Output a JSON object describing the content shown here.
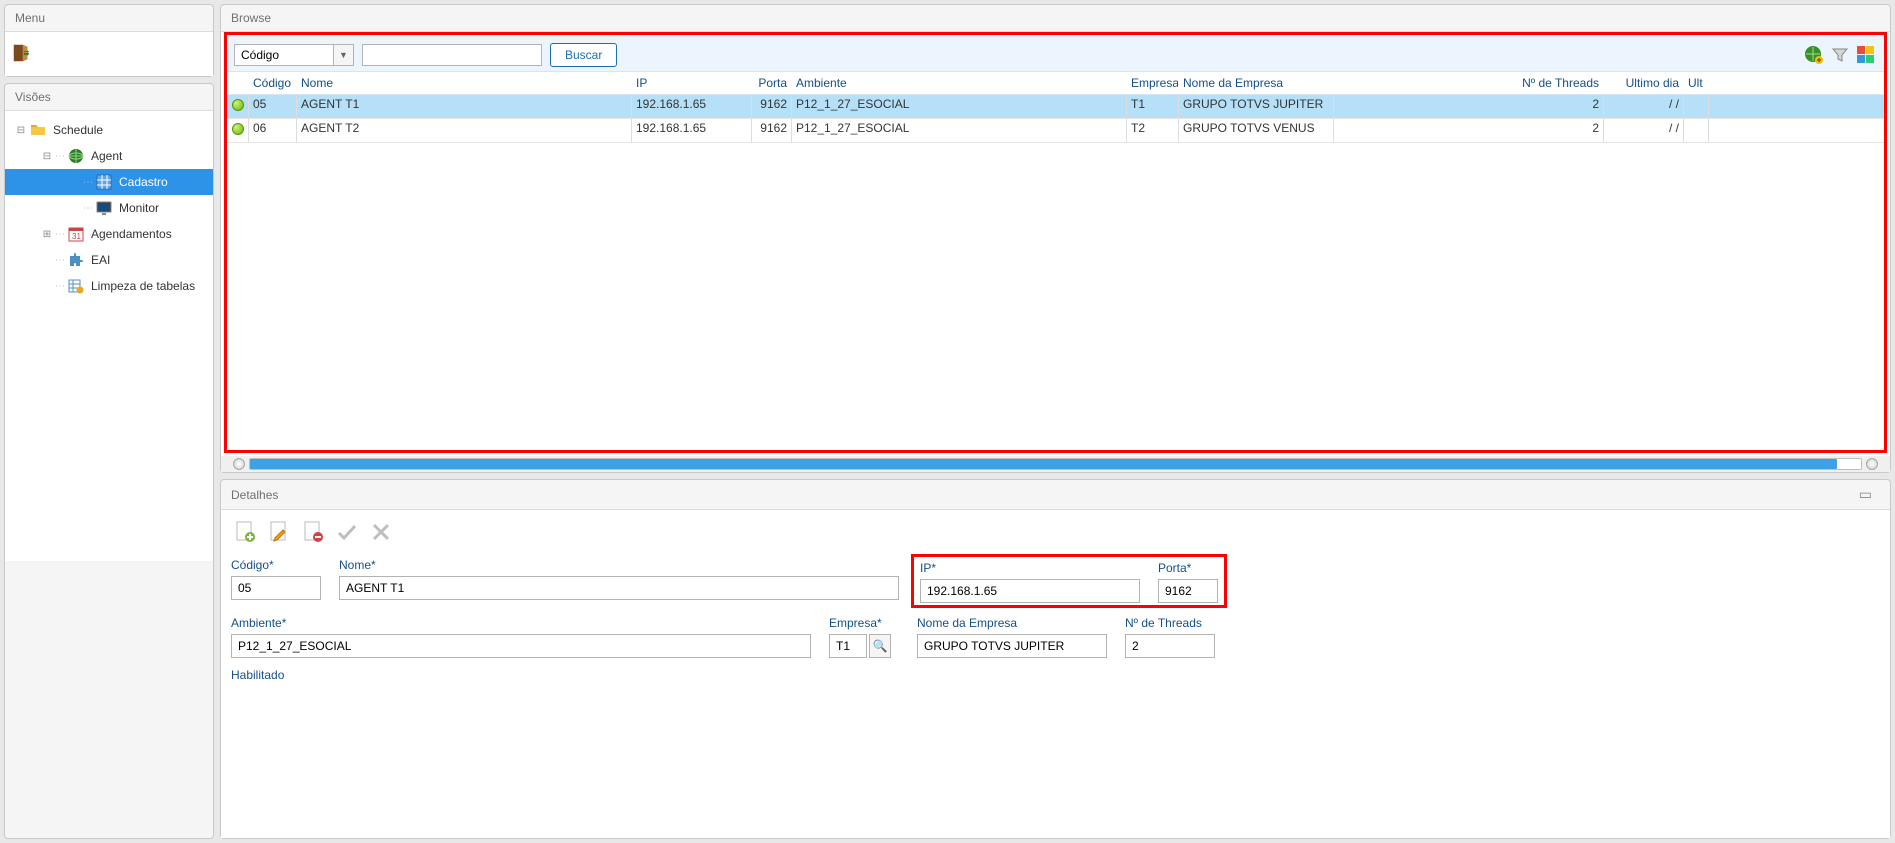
{
  "menu": {
    "title": "Menu"
  },
  "visions": {
    "title": "Visões",
    "items": [
      {
        "label": "Schedule",
        "indent": 0,
        "toggle": "⊟",
        "icon": "folder"
      },
      {
        "label": "Agent",
        "indent": 1,
        "toggle": "⊟",
        "icon": "globe"
      },
      {
        "label": "Cadastro",
        "indent": 2,
        "toggle": "",
        "icon": "grid",
        "selected": true
      },
      {
        "label": "Monitor",
        "indent": 2,
        "toggle": "",
        "icon": "monitor"
      },
      {
        "label": "Agendamentos",
        "indent": 1,
        "toggle": "⊞",
        "icon": "calendar"
      },
      {
        "label": "EAI",
        "indent": 1,
        "toggle": "",
        "icon": "puzzle"
      },
      {
        "label": "Limpeza de tabelas",
        "indent": 1,
        "toggle": "",
        "icon": "table-clean"
      }
    ]
  },
  "browse": {
    "title": "Browse",
    "search_field": "Código",
    "search_value": "",
    "search_button": "Buscar",
    "columns": [
      "",
      "Código",
      "Nome",
      "IP",
      "Porta",
      "Ambiente",
      "Empresa",
      "Nome da Empresa",
      "Nº de Threads",
      "Ultimo dia",
      "Ult"
    ],
    "rows": [
      {
        "codigo": "05",
        "nome": "AGENT T1",
        "ip": "192.168.1.65",
        "porta": "9162",
        "ambiente": "P12_1_27_ESOCIAL",
        "empresa": "T1",
        "nome_empresa": "GRUPO TOTVS JUPITER",
        "threads": "2",
        "ultimo": "/  /",
        "sel": true
      },
      {
        "codigo": "06",
        "nome": "AGENT T2",
        "ip": "192.168.1.65",
        "porta": "9162",
        "ambiente": "P12_1_27_ESOCIAL",
        "empresa": "T2",
        "nome_empresa": "GRUPO TOTVS VENUS",
        "threads": "2",
        "ultimo": "/  /",
        "sel": false
      }
    ]
  },
  "details": {
    "title": "Detalhes",
    "labels": {
      "codigo": "Código*",
      "nome": "Nome*",
      "ip": "IP*",
      "porta": "Porta*",
      "ambiente": "Ambiente*",
      "empresa": "Empresa*",
      "nome_empresa": "Nome da Empresa",
      "threads": "Nº de Threads",
      "habilitado": "Habilitado"
    },
    "values": {
      "codigo": "05",
      "nome": "AGENT T1",
      "ip": "192.168.1.65",
      "porta": "9162",
      "ambiente": "P12_1_27_ESOCIAL",
      "empresa": "T1",
      "nome_empresa": "GRUPO TOTVS JUPITER",
      "threads": "2"
    }
  }
}
